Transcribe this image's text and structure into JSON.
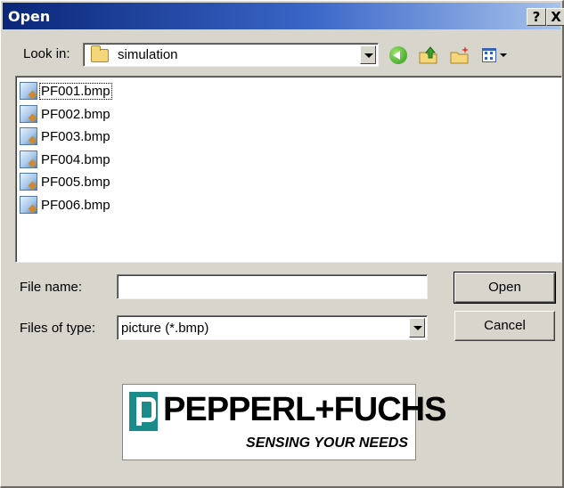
{
  "window": {
    "title": "Open",
    "help_label": "?",
    "close_label": "X"
  },
  "toolbar": {
    "look_in_label": "Look in:",
    "look_in_value": "simulation",
    "icons": [
      "back-icon",
      "up-folder-icon",
      "new-folder-icon",
      "views-menu-icon"
    ]
  },
  "files": [
    {
      "name": "PF001.bmp",
      "selected": true
    },
    {
      "name": "PF002.bmp"
    },
    {
      "name": "PF003.bmp"
    },
    {
      "name": "PF004.bmp"
    },
    {
      "name": "PF005.bmp"
    },
    {
      "name": "PF006.bmp"
    }
  ],
  "form": {
    "file_name_label": "File name:",
    "file_name_value": "",
    "file_type_label": "Files of type:",
    "file_type_value": "picture (*.bmp)"
  },
  "buttons": {
    "open": "Open",
    "cancel": "Cancel"
  },
  "logo": {
    "name": "PEPPERL+FUCHS",
    "tagline": "SENSING YOUR NEEDS"
  },
  "colors": {
    "dialog_bg": "#d8d5cd",
    "titlebar_start": "#0a2678",
    "titlebar_end": "#a7c2ec",
    "logo_teal": "#1b8a8a"
  }
}
